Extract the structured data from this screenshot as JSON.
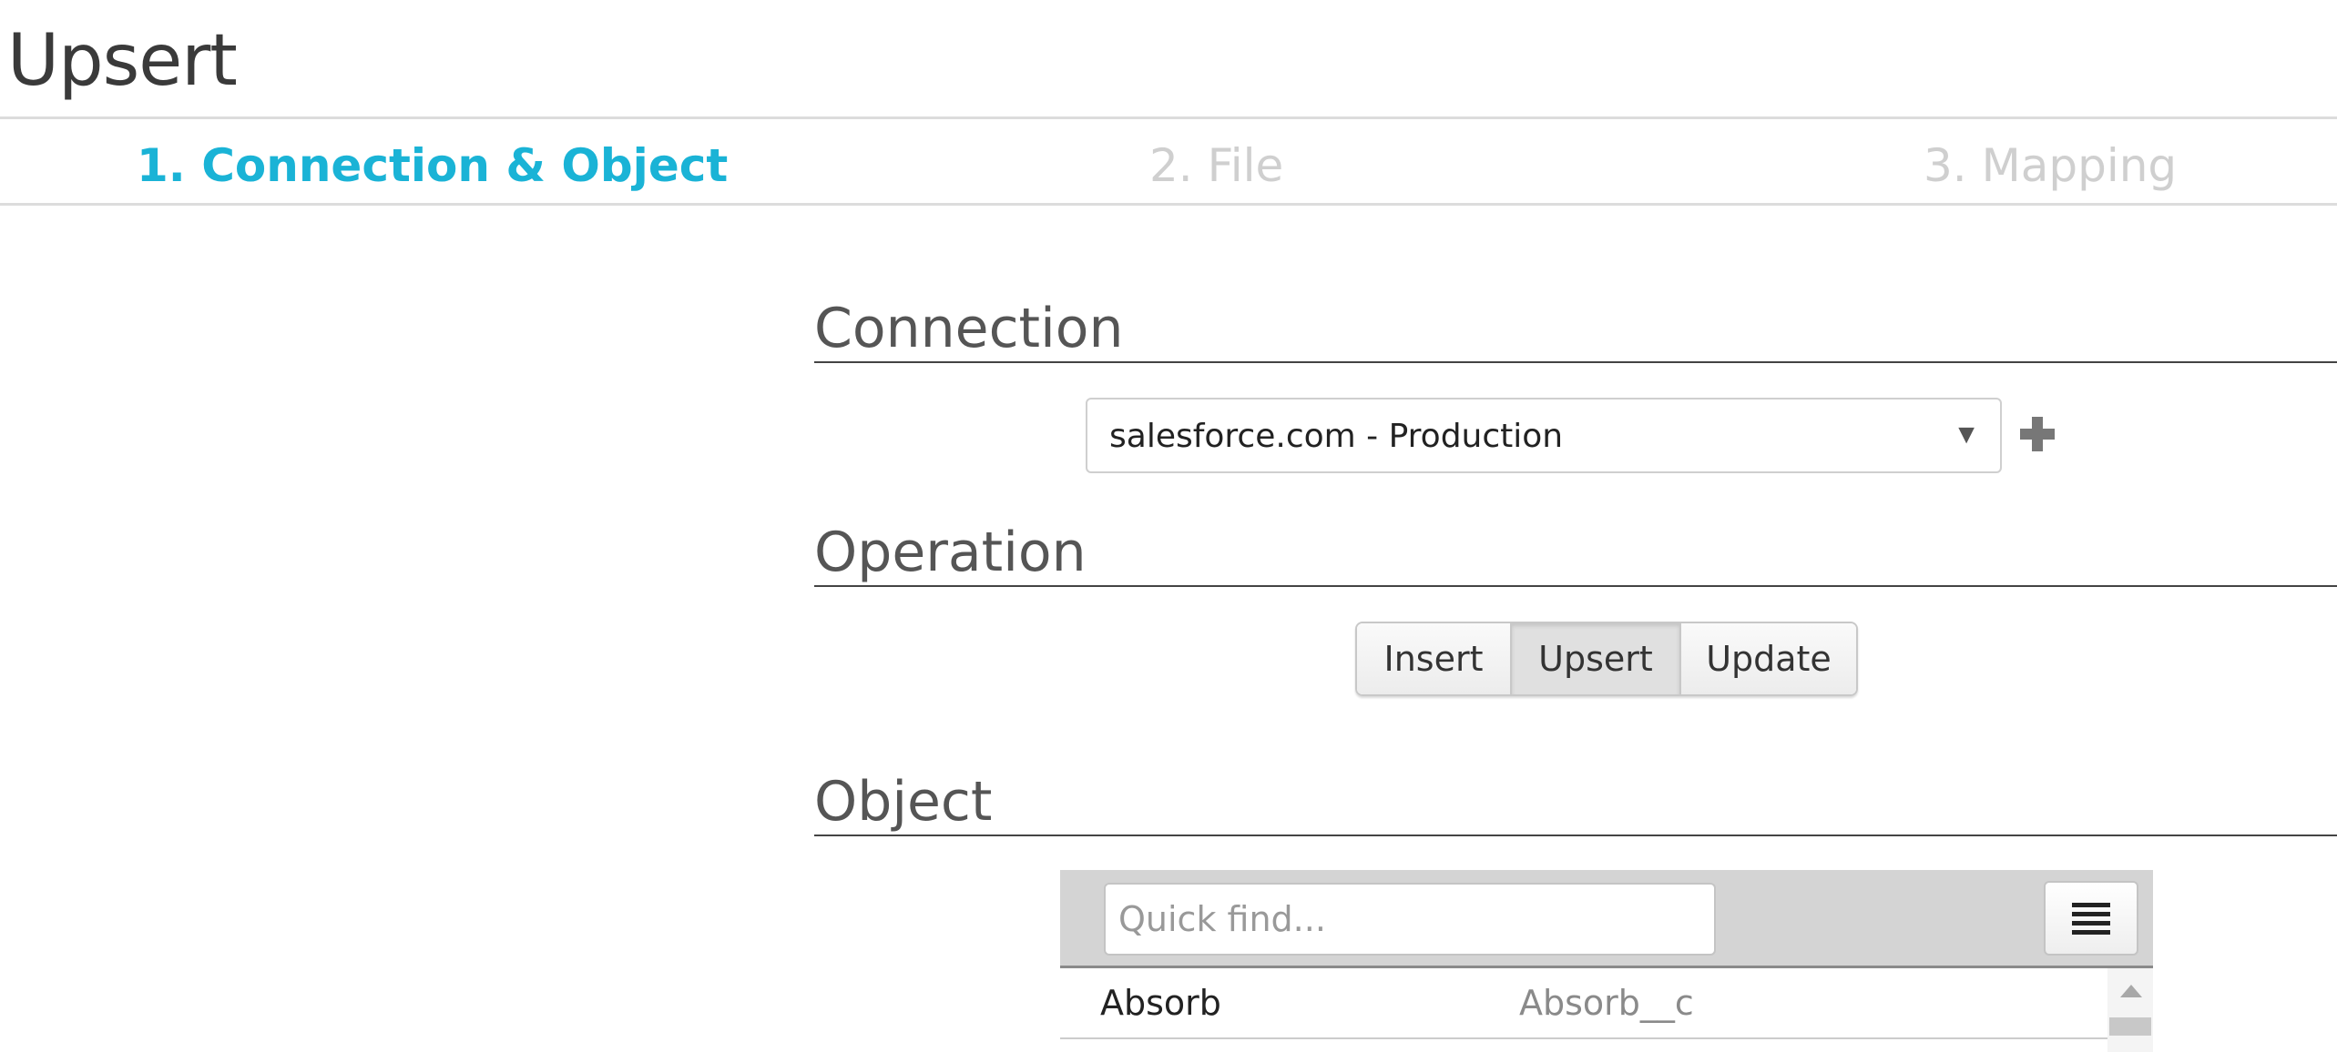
{
  "page": {
    "title": "Upsert"
  },
  "steps": [
    {
      "label": "1. Connection & Object",
      "state": "active"
    },
    {
      "label": "2. File",
      "state": "inactive"
    },
    {
      "label": "3. Mapping",
      "state": "inactive"
    }
  ],
  "connection": {
    "heading": "Connection",
    "selected": "salesforce.com - Production",
    "dropdown_icon": "triangle-down-icon",
    "add_icon": "plus-icon"
  },
  "operation": {
    "heading": "Operation",
    "options": [
      "Insert",
      "Upsert",
      "Update"
    ],
    "selected": "Upsert"
  },
  "object": {
    "heading": "Object",
    "search_placeholder": "Quick find...",
    "list_icon": "list-icon",
    "rows": [
      {
        "label": "Absorb",
        "api_name": "Absorb__c"
      }
    ]
  },
  "colors": {
    "accent": "#1ab3d6",
    "inactive_step": "#cfcfcf",
    "toolbar_bg": "#d4d4d4"
  }
}
